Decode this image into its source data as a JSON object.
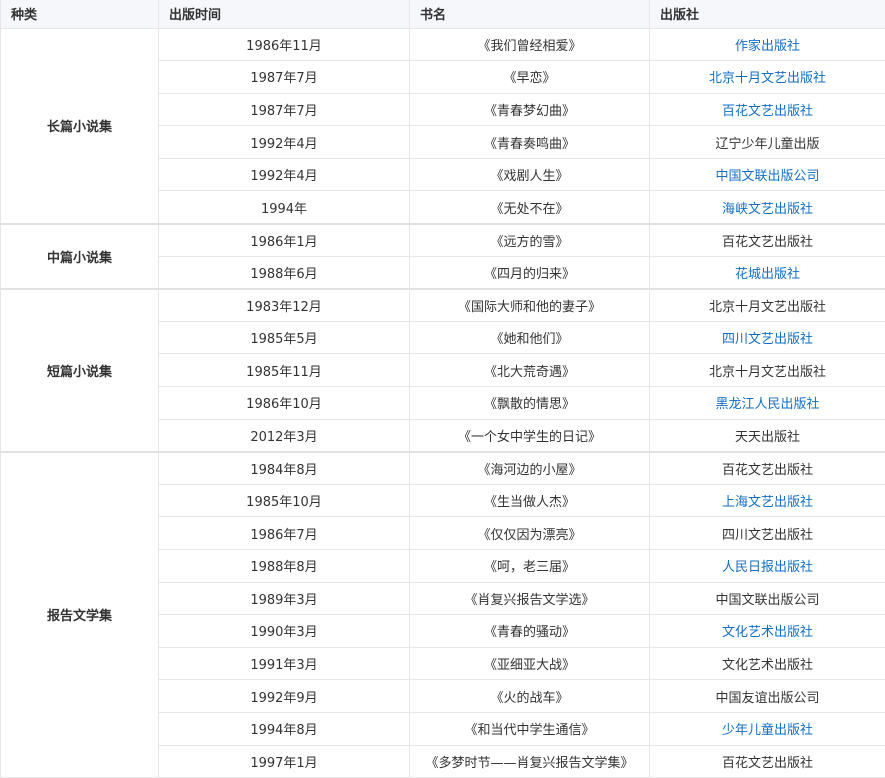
{
  "header": {
    "category": "种类",
    "date": "出版时间",
    "title": "书名",
    "publisher": "出版社"
  },
  "groups": [
    {
      "category": "长篇小说集",
      "rows": [
        {
          "date": "1986年11月",
          "title": "《我们曾经相爱》",
          "publisher": "作家出版社",
          "link": true
        },
        {
          "date": "1987年7月",
          "title": "《早恋》",
          "publisher": "北京十月文艺出版社",
          "link": true
        },
        {
          "date": "1987年7月",
          "title": "《青春梦幻曲》",
          "publisher": "百花文艺出版社",
          "link": true
        },
        {
          "date": "1992年4月",
          "title": "《青春奏鸣曲》",
          "publisher": "辽宁少年儿童出版",
          "link": false
        },
        {
          "date": "1992年4月",
          "title": "《戏剧人生》",
          "publisher": "中国文联出版公司",
          "link": true
        },
        {
          "date": "1994年",
          "title": "《无处不在》",
          "publisher": "海峡文艺出版社",
          "link": true
        }
      ]
    },
    {
      "category": "中篇小说集",
      "rows": [
        {
          "date": "1986年1月",
          "title": "《远方的雪》",
          "publisher": "百花文艺出版社",
          "link": false
        },
        {
          "date": "1988年6月",
          "title": "《四月的归来》",
          "publisher": "花城出版社",
          "link": true
        }
      ]
    },
    {
      "category": "短篇小说集",
      "rows": [
        {
          "date": "1983年12月",
          "title": "《国际大师和他的妻子》",
          "publisher": "北京十月文艺出版社",
          "link": false
        },
        {
          "date": "1985年5月",
          "title": "《她和他们》",
          "publisher": "四川文艺出版社",
          "link": true
        },
        {
          "date": "1985年11月",
          "title": "《北大荒奇遇》",
          "publisher": "北京十月文艺出版社",
          "link": false
        },
        {
          "date": "1986年10月",
          "title": "《飘散的情思》",
          "publisher": "黑龙江人民出版社",
          "link": true
        },
        {
          "date": "2012年3月",
          "title": "《一个女中学生的日记》",
          "publisher": "天天出版社",
          "link": false
        }
      ]
    },
    {
      "category": "报告文学集",
      "rows": [
        {
          "date": "1984年8月",
          "title": "《海河边的小屋》",
          "publisher": "百花文艺出版社",
          "link": false
        },
        {
          "date": "1985年10月",
          "title": "《生当做人杰》",
          "publisher": "上海文艺出版社",
          "link": true
        },
        {
          "date": "1986年7月",
          "title": "《仅仅因为漂亮》",
          "publisher": "四川文艺出版社",
          "link": false
        },
        {
          "date": "1988年8月",
          "title": "《呵，老三届》",
          "publisher": "人民日报出版社",
          "link": true
        },
        {
          "date": "1989年3月",
          "title": "《肖复兴报告文学选》",
          "publisher": "中国文联出版公司",
          "link": false
        },
        {
          "date": "1990年3月",
          "title": "《青春的骚动》",
          "publisher": "文化艺术出版社",
          "link": true
        },
        {
          "date": "1991年3月",
          "title": "《亚细亚大战》",
          "publisher": "文化艺术出版社",
          "link": false
        },
        {
          "date": "1992年9月",
          "title": "《火的战车》",
          "publisher": "中国友谊出版公司",
          "link": false
        },
        {
          "date": "1994年8月",
          "title": "《和当代中学生通信》",
          "publisher": "少年儿童出版社",
          "link": true
        },
        {
          "date": "1997年1月",
          "title": "《多梦时节——肖复兴报告文学集》",
          "publisher": "百花文艺出版社",
          "link": false
        }
      ]
    }
  ]
}
